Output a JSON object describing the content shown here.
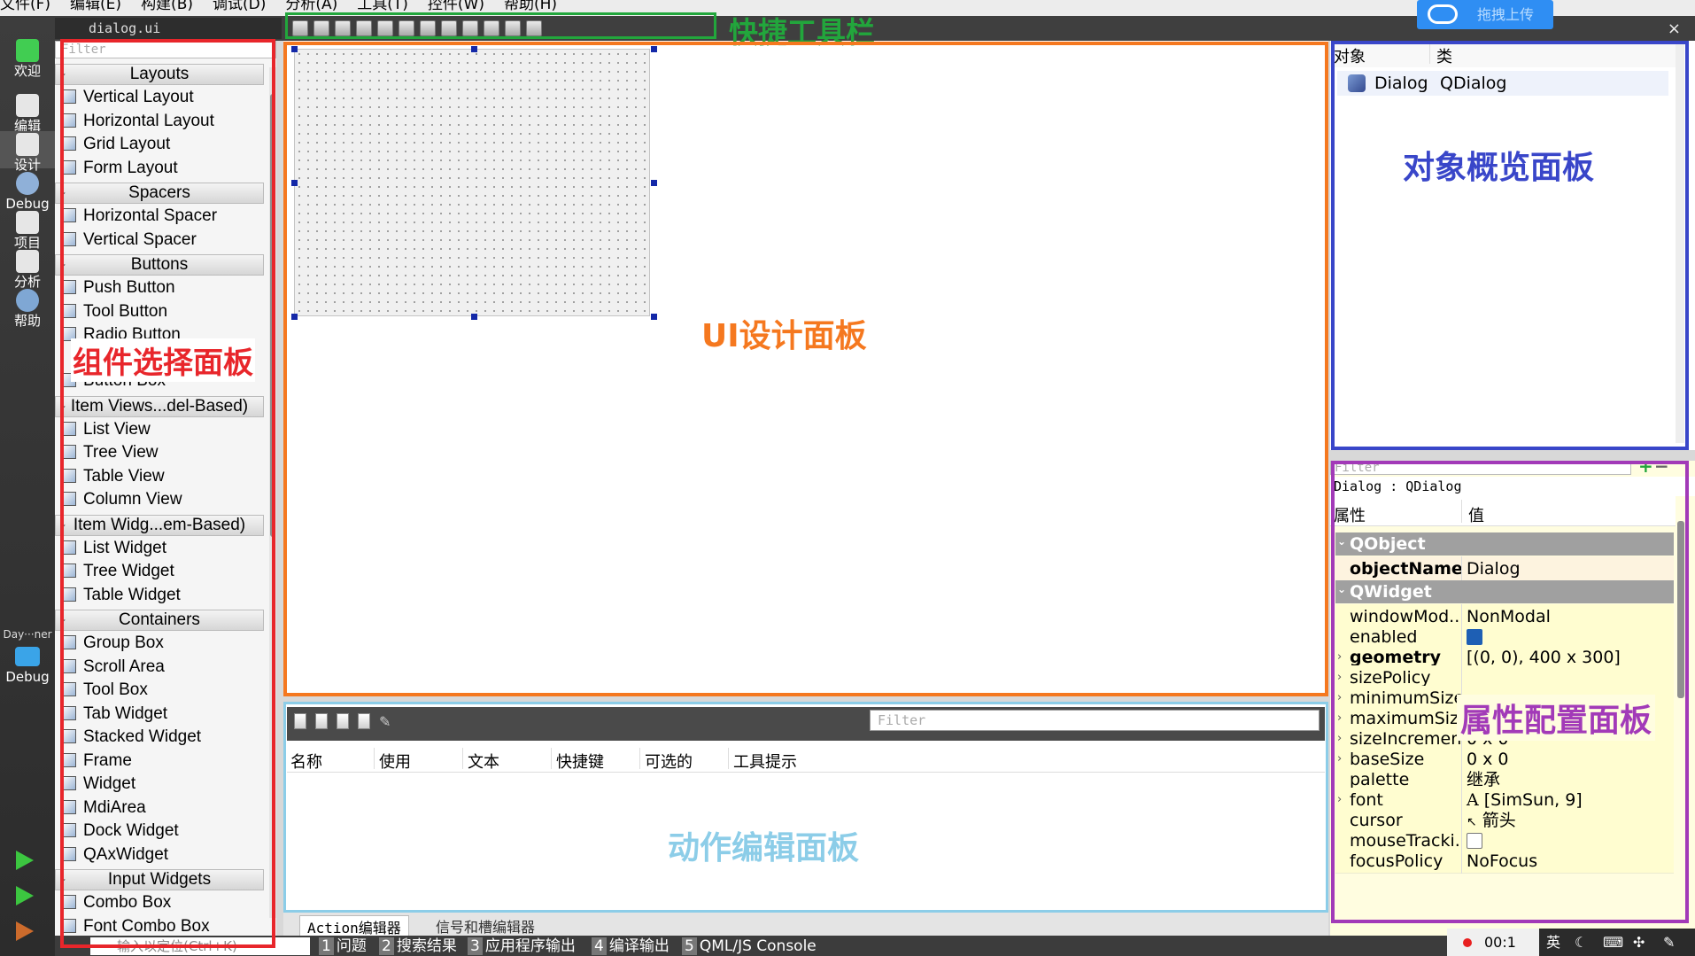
{
  "menubar": {
    "items": [
      "文件(F)",
      "编辑(E)",
      "构建(B)",
      "调试(D)",
      "分析(A)",
      "工具(T)",
      "控件(W)",
      "帮助(H)"
    ]
  },
  "modes": [
    {
      "label": "欢迎",
      "icon": "qt-logo-icon"
    },
    {
      "label": "编辑",
      "icon": "edit-document-icon"
    },
    {
      "label": "设计",
      "icon": "design-pencil-icon"
    },
    {
      "label": "Debug",
      "icon": "debug-icon"
    },
    {
      "label": "项目",
      "icon": "project-icon"
    },
    {
      "label": "分析",
      "icon": "analyze-icon"
    },
    {
      "label": "帮助",
      "icon": "help-icon"
    }
  ],
  "kit": {
    "label": "Day···ner",
    "build": "Debug"
  },
  "doc_tab": "dialog.ui",
  "close_glyph": "×",
  "upload_button": "拖拽上传",
  "widget_box": {
    "filter_placeholder": "Filter",
    "categories": [
      {
        "label": "Layouts",
        "items": [
          "Vertical Layout",
          "Horizontal Layout",
          "Grid Layout",
          "Form Layout"
        ]
      },
      {
        "label": "Spacers",
        "items": [
          "Horizontal Spacer",
          "Vertical Spacer"
        ]
      },
      {
        "label": "Buttons",
        "items": [
          "Push Button",
          "Tool Button",
          "Radio Button",
          "Button Box"
        ]
      },
      {
        "label": "Item Views...del-Based)",
        "items": [
          "List View",
          "Tree View",
          "Table View",
          "Column View"
        ]
      },
      {
        "label": "Item Widg...em-Based)",
        "items": [
          "List Widget",
          "Tree Widget",
          "Table Widget"
        ]
      },
      {
        "label": "Containers",
        "items": [
          "Group Box",
          "Scroll Area",
          "Tool Box",
          "Tab Widget",
          "Stacked Widget",
          "Frame",
          "Widget",
          "MdiArea",
          "Dock Widget",
          "QAxWidget"
        ]
      },
      {
        "label": "Input Widgets",
        "items": [
          "Combo Box",
          "Font Combo Box"
        ]
      }
    ]
  },
  "action_editor": {
    "filter_placeholder": "Filter",
    "columns": [
      "名称",
      "使用",
      "文本",
      "快捷键",
      "可选的",
      "工具提示"
    ]
  },
  "bottom_tabs": [
    "Action编辑器",
    "信号和槽编辑器"
  ],
  "status_bar": {
    "locator_placeholder": "输入以定位(Ctrl+K)",
    "panes": [
      {
        "num": "1",
        "label": "问题"
      },
      {
        "num": "2",
        "label": "搜索结果"
      },
      {
        "num": "3",
        "label": "应用程序输出"
      },
      {
        "num": "4",
        "label": "编译输出"
      },
      {
        "num": "5",
        "label": "QML/JS Console"
      }
    ]
  },
  "object_inspector": {
    "columns": [
      "对象",
      "类"
    ],
    "rows": [
      {
        "object": "Dialog",
        "class": "QDialog"
      }
    ]
  },
  "property_editor": {
    "filter_placeholder": "Filter",
    "object_line": "Dialog : QDialog",
    "columns": [
      "属性",
      "值"
    ],
    "groups": [
      {
        "label": "QObject",
        "rows": [
          {
            "name": "objectName",
            "value": "Dialog",
            "bold": true
          }
        ]
      },
      {
        "label": "QWidget",
        "rows": [
          {
            "name": "windowMod...",
            "value": "NonModal"
          },
          {
            "name": "enabled",
            "value": "",
            "checkbox": true,
            "checked": true
          },
          {
            "name": "geometry",
            "value": "[(0, 0), 400 x 300]",
            "bold": true
          },
          {
            "name": "sizePolicy",
            "value": ""
          },
          {
            "name": "minimumSize",
            "value": ""
          },
          {
            "name": "maximumSize",
            "value": ""
          },
          {
            "name": "sizeIncrement",
            "value": "0 x 0"
          },
          {
            "name": "baseSize",
            "value": "0 x 0"
          },
          {
            "name": "palette",
            "value": "继承"
          },
          {
            "name": "font",
            "value": "[SimSun, 9]"
          },
          {
            "name": "cursor",
            "value": "箭头"
          },
          {
            "name": "mouseTracki...",
            "value": "",
            "checkbox": true,
            "checked": false
          },
          {
            "name": "focusPolicy",
            "value": "NoFocus"
          }
        ]
      }
    ]
  },
  "annotations": {
    "toolbar": "快捷工具栏",
    "widget_box": "组件选择面板",
    "design_area": "UI设计面板",
    "action_editor": "动作编辑面板",
    "object_inspector": "对象概览面板",
    "property_editor": "属性配置面板"
  },
  "annotation_colors": {
    "toolbar": "#22a63c",
    "widget_box": "#e8262b",
    "design_area": "#f5781f",
    "action_editor": "#8ccde8",
    "object_inspector": "#3946c9",
    "property_editor": "#a23ab8"
  },
  "tray": {
    "ime": "英",
    "clock": "00:1"
  }
}
